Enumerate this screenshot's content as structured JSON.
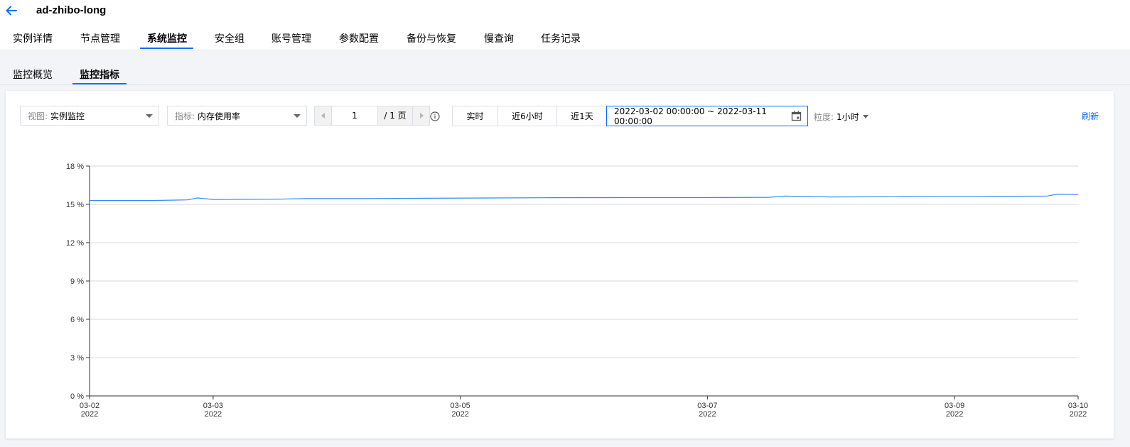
{
  "header": {
    "back_icon": "arrow-left-icon",
    "title": "ad-zhibo-long"
  },
  "tabs": [
    {
      "label": "实例详情"
    },
    {
      "label": "节点管理"
    },
    {
      "label": "系统监控",
      "active": true
    },
    {
      "label": "安全组"
    },
    {
      "label": "账号管理"
    },
    {
      "label": "参数配置"
    },
    {
      "label": "备份与恢复"
    },
    {
      "label": "慢查询"
    },
    {
      "label": "任务记录"
    }
  ],
  "subtabs": [
    {
      "label": "监控概览"
    },
    {
      "label": "监控指标",
      "active": true
    }
  ],
  "toolbar": {
    "view_label": "视图:",
    "view_value": "实例监控",
    "metric_label": "指标:",
    "metric_value": "内存使用率",
    "page_current": "1",
    "page_total": "/ 1 页",
    "range_buttons": [
      "实时",
      "近6小时",
      "近1天"
    ],
    "date_range": "2022-03-02 00:00:00 ~ 2022-03-11 00:00:00",
    "granularity_label": "粒度:",
    "granularity_value": "1小时",
    "refresh_label": "刷新"
  },
  "colors": {
    "accent": "#006eff",
    "line": "#2f8bf5"
  },
  "chart_data": {
    "type": "line",
    "title": "",
    "xlabel": "",
    "ylabel": "",
    "ylim": [
      0,
      18
    ],
    "yticks": [
      "0 %",
      "3 %",
      "6 %",
      "9 %",
      "12 %",
      "15 %",
      "18 %"
    ],
    "ytick_values": [
      0,
      3,
      6,
      9,
      12,
      15,
      18
    ],
    "xlim": [
      "2022-03-02",
      "2022-03-10"
    ],
    "xticks": [
      {
        "date": "2022-03-02",
        "label": "03-02",
        "year": "2022"
      },
      {
        "date": "2022-03-03",
        "label": "03-03",
        "year": "2022"
      },
      {
        "date": "2022-03-05",
        "label": "03-05",
        "year": "2022"
      },
      {
        "date": "2022-03-07",
        "label": "03-07",
        "year": "2022"
      },
      {
        "date": "2022-03-09",
        "label": "03-09",
        "year": "2022"
      },
      {
        "date": "2022-03-10",
        "label": "03-10",
        "year": "2022"
      }
    ],
    "grid": true,
    "series": [
      {
        "x": [
          "2022-03-02 00:00",
          "2022-03-02 12:00",
          "2022-03-02 19:00",
          "2022-03-02 21:00",
          "2022-03-03 00:00",
          "2022-03-03 12:00",
          "2022-03-03 18:00",
          "2022-03-04 06:00",
          "2022-03-04 18:00",
          "2022-03-05 06:00",
          "2022-03-05 18:00",
          "2022-03-06 12:00",
          "2022-03-07 00:00",
          "2022-03-07 12:00",
          "2022-03-07 15:00",
          "2022-03-08 00:00",
          "2022-03-08 12:00",
          "2022-03-08 20:00",
          "2022-03-09 06:00",
          "2022-03-09 18:00",
          "2022-03-09 20:00",
          "2022-03-10 00:00"
        ],
        "values": [
          15.3,
          15.3,
          15.35,
          15.5,
          15.38,
          15.4,
          15.45,
          15.45,
          15.48,
          15.5,
          15.52,
          15.53,
          15.53,
          15.55,
          15.65,
          15.58,
          15.6,
          15.62,
          15.62,
          15.65,
          15.8,
          15.78
        ]
      }
    ]
  }
}
